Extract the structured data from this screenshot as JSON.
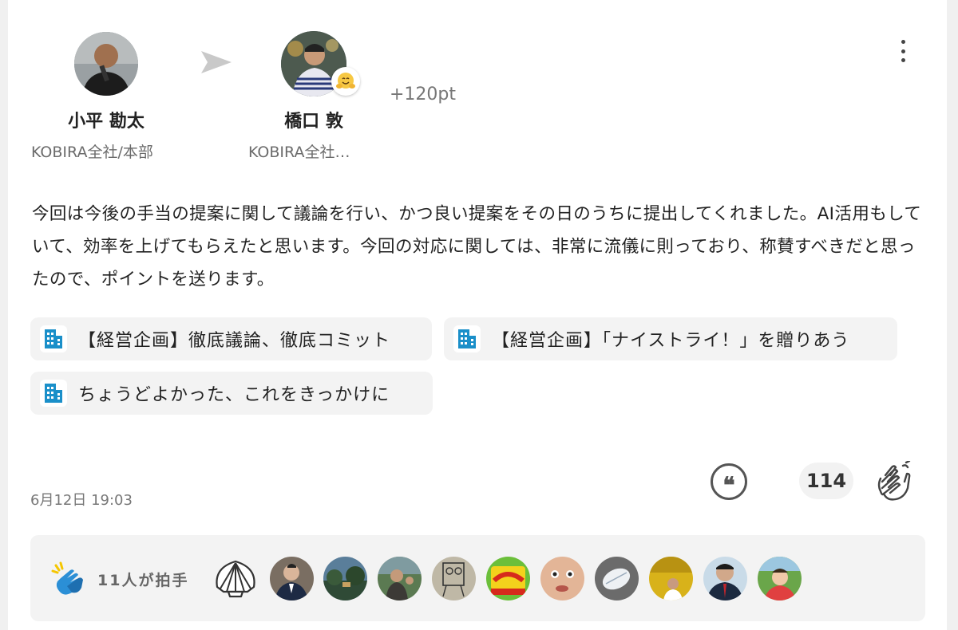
{
  "sender": {
    "name": "小平 勘太",
    "department": "KOBIRA全社/本部"
  },
  "receiver": {
    "name": "橋口 敦",
    "department": "KOBIRA全社…",
    "reaction_emoji": "hugging-face"
  },
  "points": "+120pt",
  "message": "今回は今後の手当の提案に関して議論を行い、かつ良い提案をその日のうちに提出してくれました。AI活用もしていて、効率を上げてもらえたと思います。今回の対応に関しては、非常に流儀に則っており、称賛すべきだと思ったので、ポイントを送ります。",
  "tags": [
    {
      "label": "【経営企画】徹底議論、徹底コミット",
      "icon": "building-icon"
    },
    {
      "label": "【経営企画】「ナイストライ！」を贈りあう",
      "icon": "building-icon"
    },
    {
      "label": "ちょうどよかった、これをきっかけに",
      "icon": "building-icon"
    }
  ],
  "timestamp": "6月12日 19:03",
  "actions": {
    "quote_icon": "quote-icon",
    "clap_count": "114",
    "clap_icon": "clapping-hands-icon"
  },
  "clappers": {
    "label": "11人が拍手",
    "icon": "clapping-hands-icon",
    "shell_icon": "shell-icon",
    "avatars": [
      "avatar-man-suit",
      "avatar-landscape",
      "avatar-man-outdoor",
      "avatar-drawing",
      "avatar-snack",
      "avatar-face-closeup",
      "avatar-plate",
      "avatar-woman-yellow",
      "avatar-man-tie",
      "avatar-child"
    ]
  },
  "colors": {
    "tag_icon": "#1a8fc9",
    "clap_blue": "#2b8fd6",
    "clap_yellow": "#f5c600"
  }
}
